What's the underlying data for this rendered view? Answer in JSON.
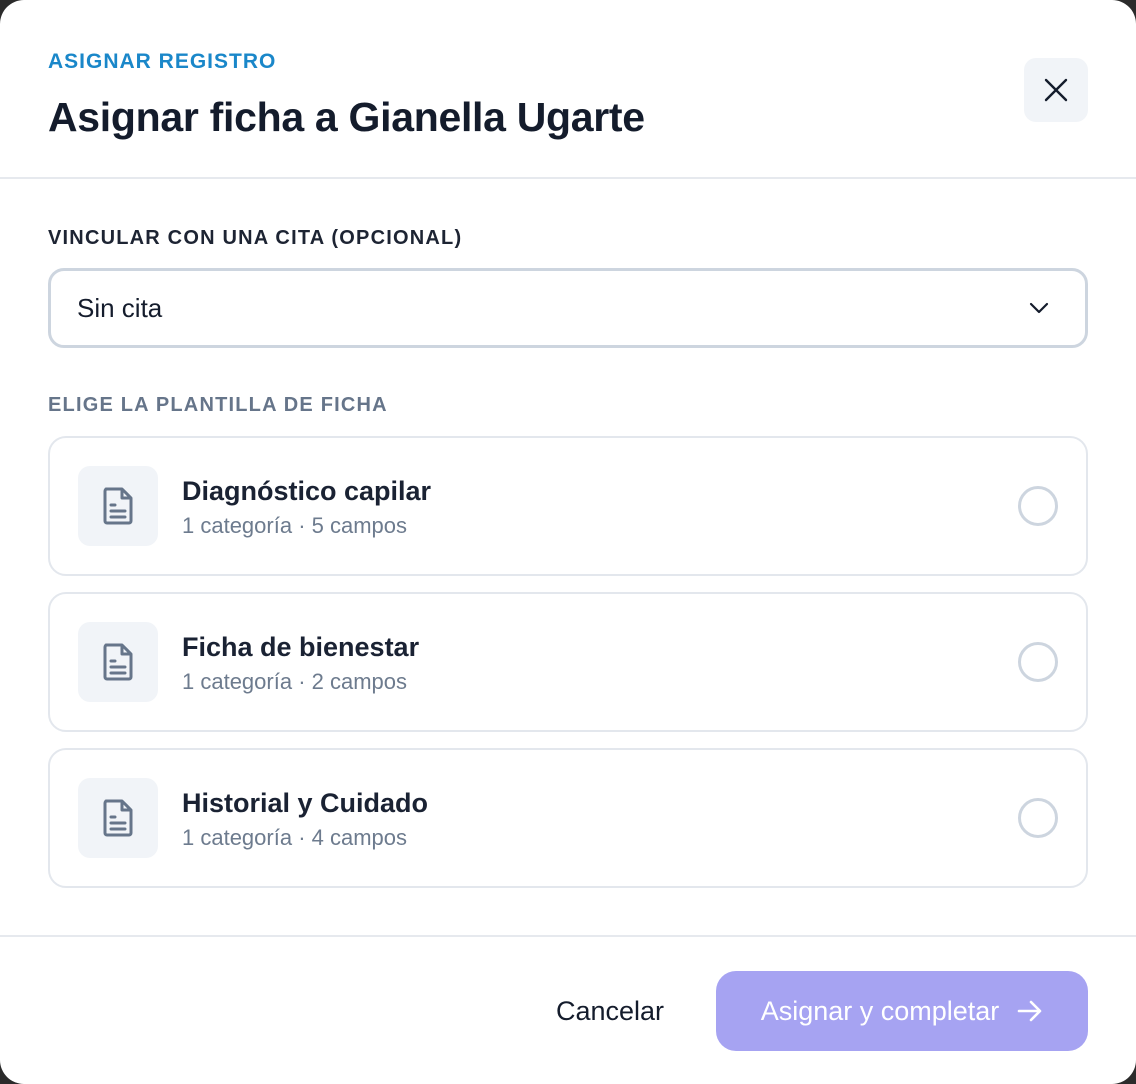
{
  "header": {
    "eyebrow": "ASIGNAR REGISTRO",
    "title": "Asignar ficha a Gianella Ugarte",
    "close_icon": "close-icon"
  },
  "appointment": {
    "label": "VINCULAR CON UNA CITA (OPCIONAL)",
    "selected": "Sin cita",
    "icon": "chevron-down-icon"
  },
  "templates": {
    "label": "ELIGE LA PLANTILLA DE FICHA",
    "items": [
      {
        "title": "Diagnóstico capilar",
        "meta": "1 categoría · 5 campos",
        "icon": "document-icon",
        "selected": false
      },
      {
        "title": "Ficha de bienestar",
        "meta": "1 categoría · 2 campos",
        "icon": "document-icon",
        "selected": false
      },
      {
        "title": "Historial y Cuidado",
        "meta": "1 categoría · 4 campos",
        "icon": "document-icon",
        "selected": false
      }
    ]
  },
  "footer": {
    "cancel_label": "Cancelar",
    "submit_label": "Asignar y completar",
    "submit_icon": "arrow-right-icon"
  },
  "colors": {
    "accent": "#1a87c9",
    "primary_disabled": "#a6a3f2",
    "text": "#141c2c",
    "muted": "#6d7b8e"
  }
}
